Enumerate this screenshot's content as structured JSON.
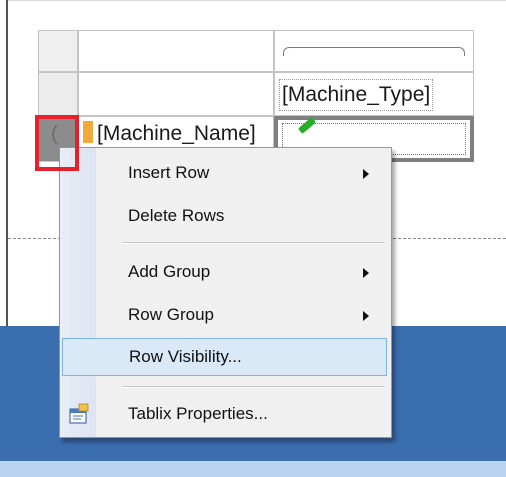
{
  "tablix": {
    "header_field": "[Machine_Type]",
    "detail_field": "[Machine_Name]"
  },
  "context_menu": {
    "items": [
      {
        "label": "Insert Row",
        "has_submenu": true
      },
      {
        "label": "Delete Rows",
        "has_submenu": false
      },
      {
        "label": "Add Group",
        "has_submenu": true
      },
      {
        "label": "Row Group",
        "has_submenu": true
      },
      {
        "label": "Row Visibility...",
        "has_submenu": false,
        "highlighted": true
      },
      {
        "label": "Tablix Properties...",
        "has_submenu": false,
        "icon": "properties-icon"
      }
    ]
  },
  "colors": {
    "highlight_border": "#e8202a",
    "menu_hover_bg": "#d9e9f8",
    "background_blue": "#3b6eaf"
  }
}
